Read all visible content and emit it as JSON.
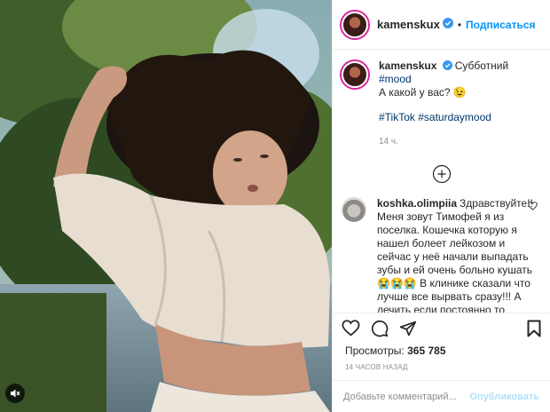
{
  "post": {
    "username": "kamenskux",
    "follow_label": "Подписаться",
    "separator": "•",
    "caption_text": "Субботний ",
    "caption_hashtag": "#mood",
    "caption_line2": "А какой у вас? 😉",
    "tags": "#TikTok #saturdaymood",
    "time_ago": "14 ч."
  },
  "comment": {
    "username": "koshka.olimpiia",
    "text": "Здравствуйте!! Меня зовут Тимофей я из поселка. Кошечка которую я нашел болеет лейкозом и сейчас у неё начали выпадать зубы и ей очень больно кушать 😭😭😭 В клинике сказали что лучше все вырвать сразу!!! А лечить если постоянно то"
  },
  "stats": {
    "views_label": "Просмотры:",
    "views_count": "365 785",
    "posted_ago": "14 ЧАСОВ НАЗАД"
  },
  "composer": {
    "placeholder": "Добавьте комментарий...",
    "post_label": "Опубликовать"
  },
  "icons": {
    "verified": "verified-badge-icon",
    "load_more": "plus-circle-icon",
    "like": "heart-icon",
    "comment": "comment-icon",
    "share": "share-icon",
    "save": "bookmark-icon",
    "mute": "sound-off-icon"
  },
  "colors": {
    "link": "#0095f6",
    "hashtag": "#00376b",
    "muted": "#8e8e8e"
  }
}
